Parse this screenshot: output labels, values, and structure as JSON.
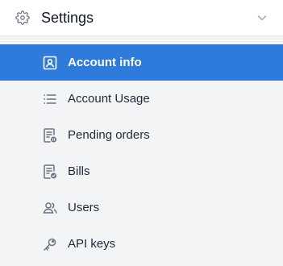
{
  "header": {
    "title": "Settings",
    "icon": "gear-icon",
    "chevron_icon": "chevron-down-icon"
  },
  "menu": {
    "items": [
      {
        "label": "Account info",
        "icon": "account-card-icon",
        "active": true
      },
      {
        "label": "Account Usage",
        "icon": "list-icon",
        "active": false
      },
      {
        "label": "Pending orders",
        "icon": "pending-orders-icon",
        "active": false
      },
      {
        "label": "Bills",
        "icon": "bills-icon",
        "active": false
      },
      {
        "label": "Users",
        "icon": "users-icon",
        "active": false
      },
      {
        "label": "API keys",
        "icon": "key-icon",
        "active": false
      }
    ]
  },
  "colors": {
    "accent": "#2f7bdc",
    "background": "#f3f4f6",
    "header_bg": "#ffffff",
    "icon_gray": "#6b7280"
  }
}
